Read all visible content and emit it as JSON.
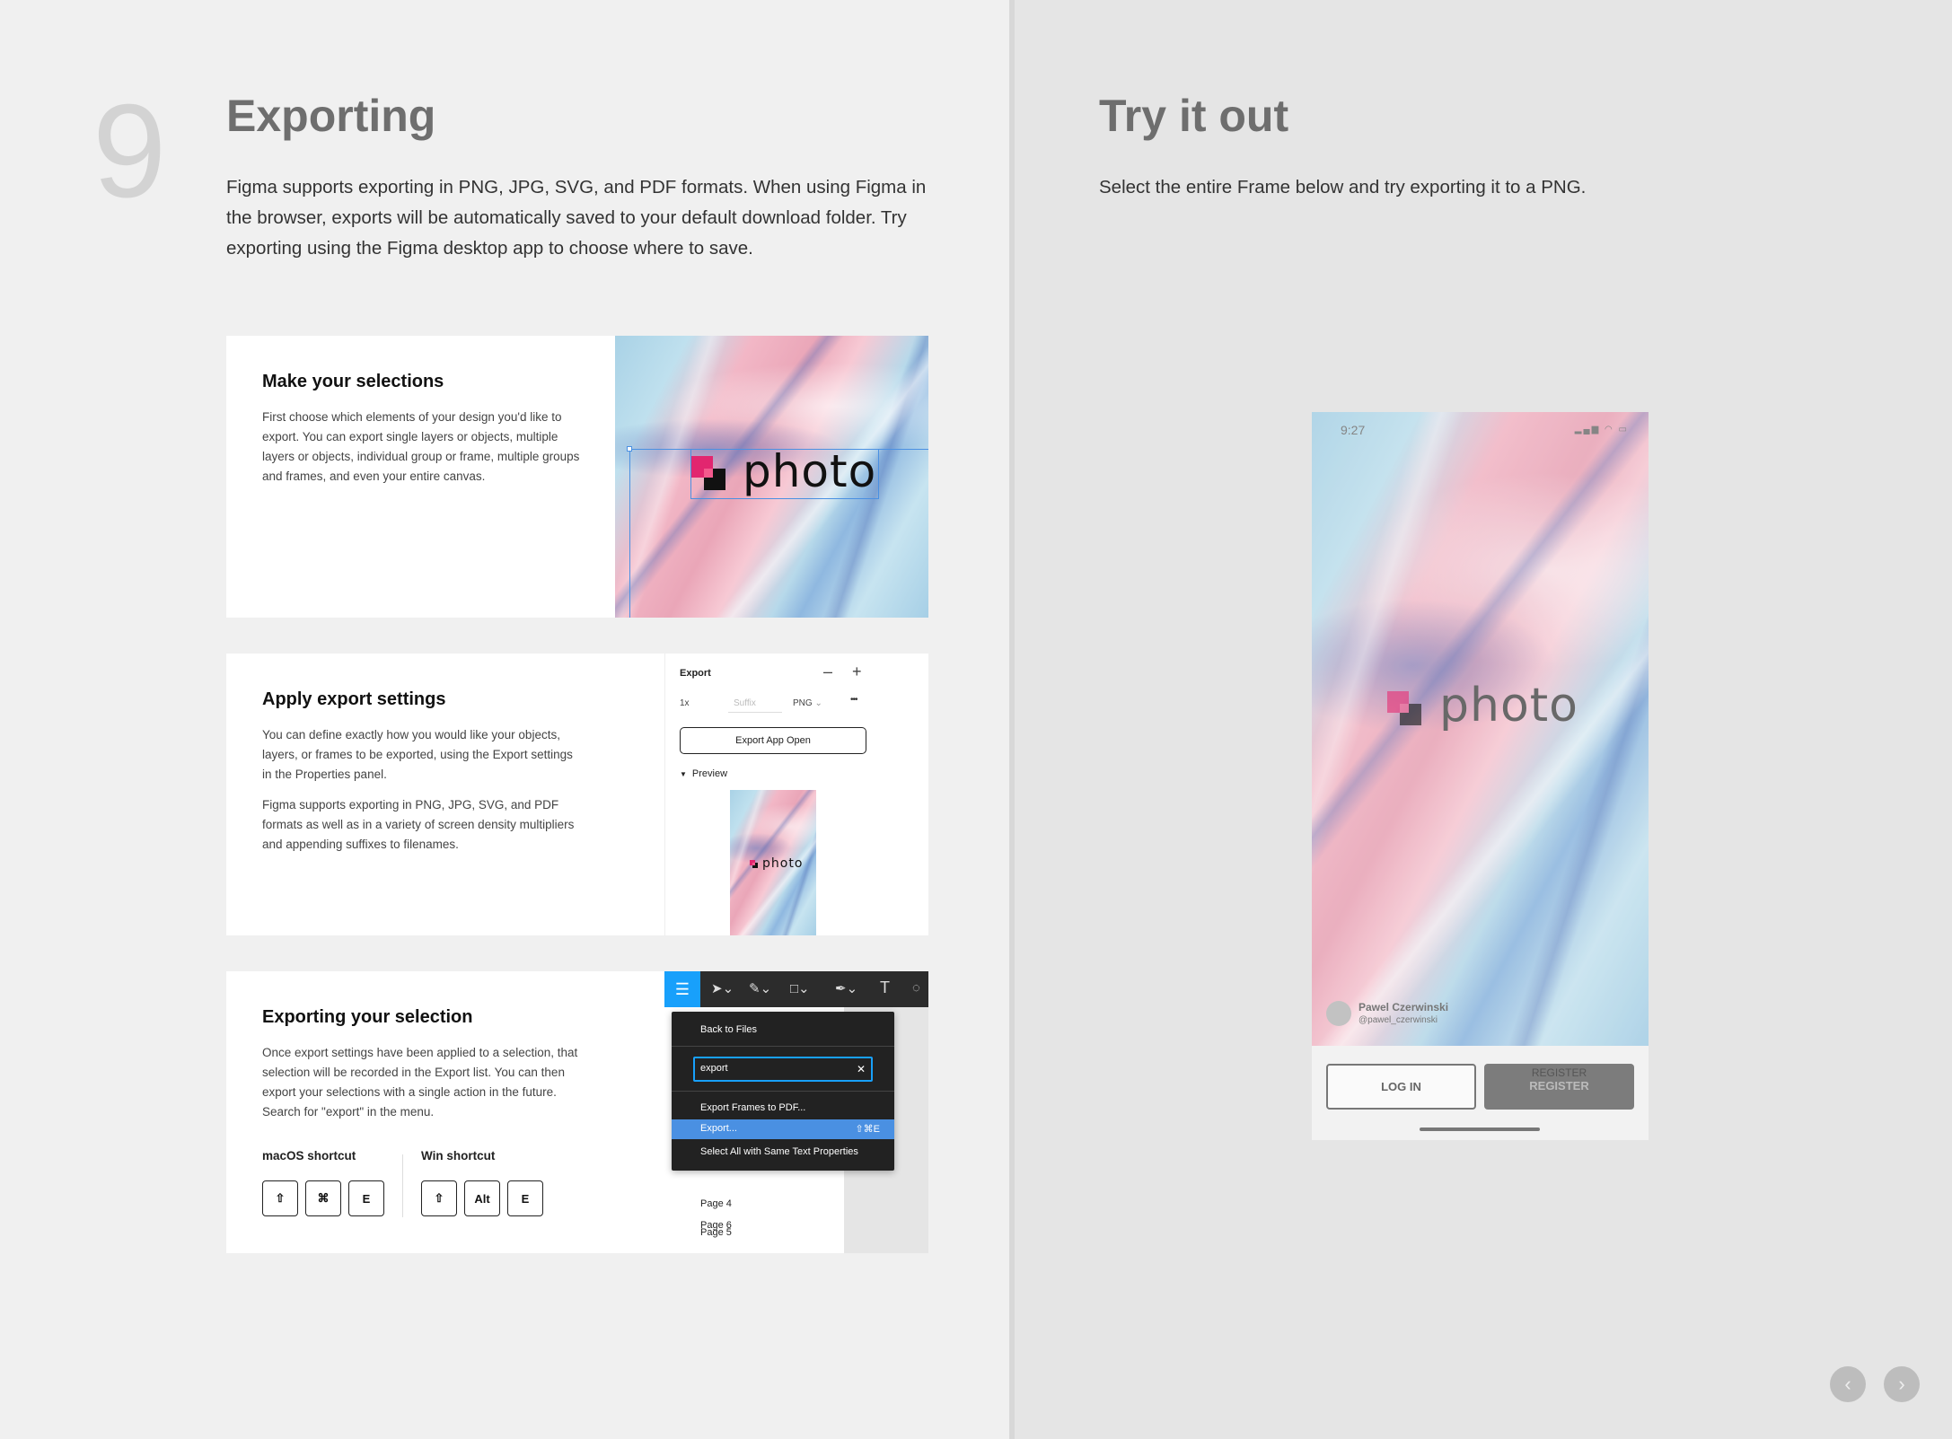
{
  "left": {
    "step_number": "9",
    "title": "Exporting",
    "intro": "Figma supports exporting in PNG, JPG, SVG, and PDF formats. When using Figma in the browser, exports will be automatically saved to your default download folder. Try exporting using the Figma desktop app to choose where to save."
  },
  "card1": {
    "title": "Make your selections",
    "body": "First choose which elements of your design you'd like to export. You can export single layers or objects, multiple layers or objects, individual group or frame, multiple groups and frames, and even your entire canvas.",
    "logo_text": "photo"
  },
  "card2": {
    "title": "Apply export settings",
    "body1": "You can define exactly how you would like your objects, layers, or frames to be exported, using the Export settings in the Properties panel.",
    "body2": "Figma supports exporting in PNG, JPG, SVG, and PDF formats as well as in a variety of screen density multipliers and appending suffixes to filenames.",
    "panel": {
      "header": "Export",
      "minus": "–",
      "plus": "+",
      "scale": "1x",
      "suffix_placeholder": "Suffix",
      "format": "PNG",
      "more": "•••",
      "export_button": "Export App Open",
      "preview_label": "Preview",
      "preview_logo_text": "photo"
    }
  },
  "card3": {
    "title": "Exporting your selection",
    "body": "Once export settings have been applied to a selection, that selection will be recorded in the Export list. You can then export your selections with a single action in the future. Search for \"export\" in the menu.",
    "mac_label": "macOS shortcut",
    "mac_keys": [
      "⇧",
      "⌘",
      "E"
    ],
    "win_label": "Win shortcut",
    "win_keys": [
      "⇧",
      "Alt",
      "E"
    ],
    "menu": {
      "back": "Back to Files",
      "search_value": "export",
      "items": [
        {
          "label": "Export Frames to PDF...",
          "shortcut": ""
        },
        {
          "label": "Export...",
          "shortcut": "⇧⌘E"
        },
        {
          "label": "Select All with Same Text Properties",
          "shortcut": ""
        }
      ],
      "pages": [
        {
          "label": "Page 4",
          "checked": false
        },
        {
          "label": "Page 5",
          "checked": false
        },
        {
          "label": "Page 6",
          "checked": true
        }
      ]
    }
  },
  "right": {
    "title": "Try it out",
    "instruction": "Select the entire Frame below and try exporting it to a PNG.",
    "phone": {
      "time": "9:27",
      "logo_text": "photo",
      "credit_name": "Pawel Czerwinski",
      "credit_handle": "@pawel_czerwinski",
      "login_button": "LOG IN",
      "register_label_top": "REGISTER",
      "register_button": "REGISTER"
    },
    "prev_button": "‹",
    "next_button": "›"
  },
  "colors": {
    "accent_blue": "#18a0fb",
    "menu_bg": "#222222",
    "menu_highlight": "#4a90e2",
    "toolbar_bg": "#2c2c2c"
  }
}
